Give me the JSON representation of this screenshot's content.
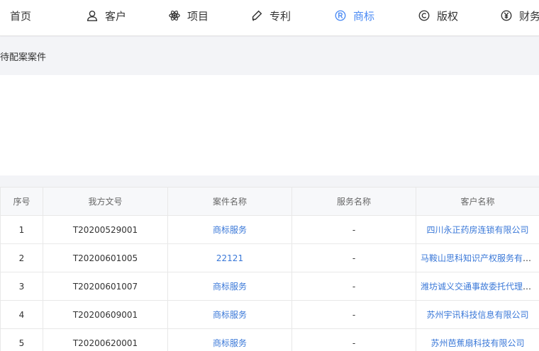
{
  "nav": {
    "items": [
      {
        "label": "首页",
        "icon": null
      },
      {
        "label": "客户",
        "icon": "user-icon"
      },
      {
        "label": "项目",
        "icon": "atom-icon"
      },
      {
        "label": "专利",
        "icon": "pen-icon"
      },
      {
        "label": "商标",
        "icon": "registered-icon",
        "active": true
      },
      {
        "label": "版权",
        "icon": "copyright-icon"
      },
      {
        "label": "财务",
        "icon": "yen-icon"
      }
    ],
    "active_color": "#4a8af4"
  },
  "section": {
    "title": "待配案案件"
  },
  "table": {
    "headers": [
      "序号",
      "我方文号",
      "案件名称",
      "服务名称",
      "客户名称"
    ],
    "rows": [
      {
        "index": "1",
        "our_ref": "T20200529001",
        "case_name": "商标服务",
        "service": "-",
        "client": "四川永正药房连锁有限公司"
      },
      {
        "index": "2",
        "our_ref": "T20200601005",
        "case_name": "22121",
        "service": "-",
        "client": "马鞍山思科知识产权服务有限公司"
      },
      {
        "index": "3",
        "our_ref": "T20200601007",
        "case_name": "商标服务",
        "service": "-",
        "client": "潍坊诚义交通事故委托代理有限公司"
      },
      {
        "index": "4",
        "our_ref": "T20200609001",
        "case_name": "商标服务",
        "service": "-",
        "client": "苏州宇讯科技信息有限公司"
      },
      {
        "index": "5",
        "our_ref": "T20200620001",
        "case_name": "商标服务",
        "service": "-",
        "client": "苏州芭蕉扇科技有限公司"
      }
    ],
    "link_color": "#3a78d8"
  }
}
